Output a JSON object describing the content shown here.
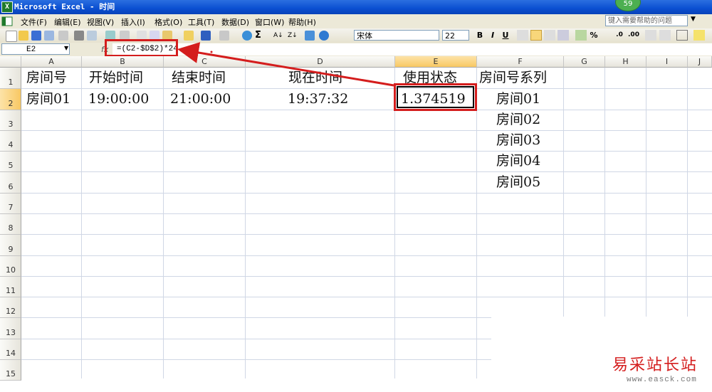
{
  "window": {
    "title": "Microsoft Excel - 时间",
    "badge": "59"
  },
  "menu": [
    "文件(F)",
    "编辑(E)",
    "视图(V)",
    "插入(I)",
    "格式(O)",
    "工具(T)",
    "数据(D)",
    "窗口(W)",
    "帮助(H)"
  ],
  "help_placeholder": "键入需要帮助的问题",
  "toolbar": {
    "font": "宋体",
    "size": "22",
    "bold": "B",
    "italic": "I",
    "underline": "U",
    "percent": "%"
  },
  "formula_bar": {
    "name_box": "E2",
    "fx": "fx",
    "formula": "=(C2-$D$2)*24"
  },
  "columns": [
    "A",
    "B",
    "C",
    "D",
    "E",
    "F",
    "G",
    "H",
    "I",
    "J"
  ],
  "rows": [
    "1",
    "2",
    "3",
    "4",
    "5",
    "6",
    "7",
    "8",
    "9",
    "10",
    "11",
    "12",
    "13",
    "14",
    "15"
  ],
  "cells": {
    "A1": "房间号",
    "B1": "开始时间",
    "C1": "结束时间",
    "D1": "现在时间",
    "E1": "使用状态",
    "F1": "房间号系列",
    "A2": "房间01",
    "B2": "19:00:00",
    "C2": "21:00:00",
    "D2": "19:37:32",
    "E2": "1.374519",
    "F2": "房间01",
    "F3": "房间02",
    "F4": "房间03",
    "F5": "房间04",
    "F6": "房间05"
  },
  "watermark": {
    "text": "易采站长站",
    "url": "www.easck.com"
  },
  "colors": {
    "highlight": "#d41d1d",
    "title_bar": "#0a4fd1",
    "selected_header": "#f8c863"
  }
}
